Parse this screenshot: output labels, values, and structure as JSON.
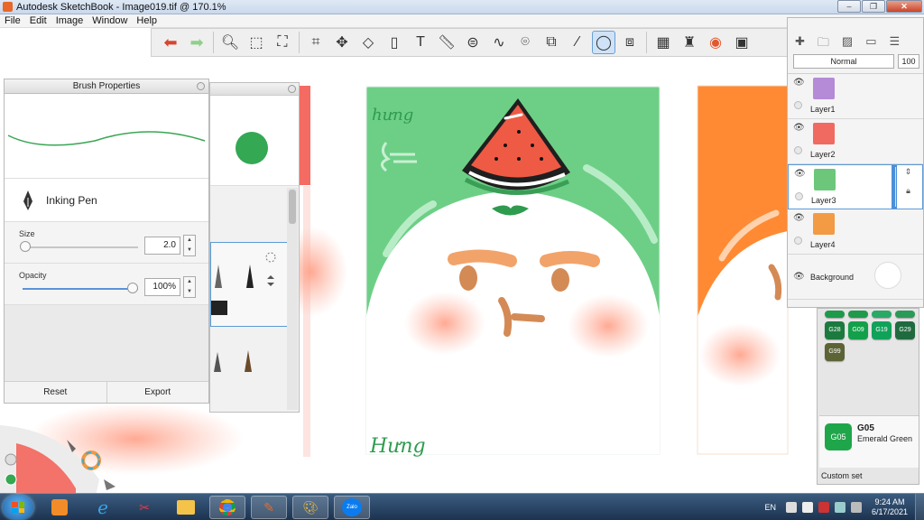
{
  "window": {
    "title": "Autodesk SketchBook - Image019.tif @ 170.1%",
    "minimize": "–",
    "maximize": "❐",
    "close": "✕"
  },
  "menu": [
    "File",
    "Edit",
    "Image",
    "Window",
    "Help"
  ],
  "toolbar": {
    "tools": [
      "undo-icon",
      "redo-icon",
      "zoom-icon",
      "rect-select-icon",
      "lasso-select-icon",
      "crop-icon",
      "transform-icon",
      "distort-icon",
      "fill-icon",
      "text-icon",
      "ruler-icon",
      "ellipse-guide-icon",
      "french-curve-icon",
      "perspective-icon",
      "symmetry-icon",
      "stroke-icon",
      "predictive-stroke-icon",
      "shape-icon",
      "copic-icon",
      "brushes-icon",
      "color-wheel-icon",
      "palette-icon"
    ],
    "active_tool": "predictive-stroke-icon"
  },
  "brush_properties": {
    "title": "Brush Properties",
    "brush_name": "Inking Pen",
    "size_label": "Size",
    "size_value": "2.0",
    "size_fraction": 0.02,
    "opacity_label": "Opacity",
    "opacity_value": "100%",
    "opacity_fraction": 1.0,
    "reset_label": "Reset",
    "export_label": "Export",
    "stroke_color": "#3aa655"
  },
  "brush_palette": {
    "current_color": "#34a853"
  },
  "layers": {
    "blend_mode": "Normal",
    "opacity": "100",
    "items": [
      {
        "name": "Layer1",
        "thumb_color": "#b58ad6",
        "selected": false
      },
      {
        "name": "Layer2",
        "thumb_color": "#f06a62",
        "selected": false
      },
      {
        "name": "Layer3",
        "thumb_color": "#6cc77a",
        "selected": true
      },
      {
        "name": "Layer4",
        "thumb_color": "#f39a45",
        "selected": false
      }
    ],
    "background_name": "Background"
  },
  "copic": {
    "chips": [
      {
        "code": "",
        "color": "#1e9a4a"
      },
      {
        "code": "",
        "color": "#1e9a4a"
      },
      {
        "code": "",
        "color": "#2aa866"
      },
      {
        "code": "",
        "color": "#2b9a58"
      },
      {
        "code": "G28",
        "color": "#1c7a3e"
      },
      {
        "code": "G09",
        "color": "#14a04a"
      },
      {
        "code": "G19",
        "color": "#11a25a"
      },
      {
        "code": "G29",
        "color": "#1f6b3f"
      },
      {
        "code": "G99",
        "color": "#5c6436"
      }
    ],
    "current_code": "G05",
    "current_name": "Emerald Green",
    "current_color": "#1fa64a",
    "custom_set_label": "Custom set"
  },
  "taskbar": {
    "language": "EN",
    "time": "9:24 AM",
    "date": "6/17/2021",
    "apps": [
      "media-player-icon",
      "internet-explorer-icon",
      "snipping-tool-icon",
      "file-explorer-icon",
      "chrome-icon",
      "sketchbook-icon",
      "paint-icon",
      "zalo-icon"
    ],
    "zalo_label": "Zalo"
  },
  "canvas_art": {
    "signature_top": "hưng",
    "signature_bottom": "Hưng",
    "card_green": "#6dcf86",
    "card_left": "#f36b63",
    "card_right": "#ff8a33",
    "watermelon_flesh": "#ef5a44",
    "watermelon_rind": "#3a9e56"
  }
}
